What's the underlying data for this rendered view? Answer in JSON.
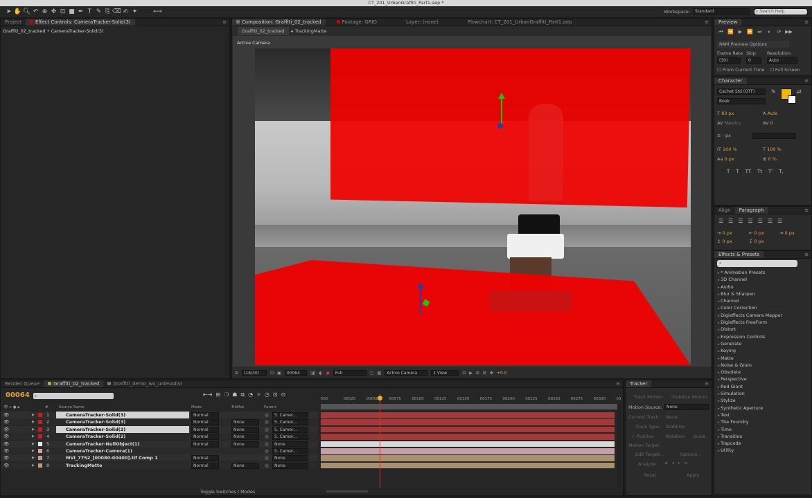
{
  "window": {
    "title": "CT_201_UrbanGraffiti_Part1.aep *"
  },
  "toolbar": {
    "workspace_label": "Workspace:",
    "workspace_value": "Standard",
    "search_placeholder": "Search Help"
  },
  "project_panel": {
    "tab_project": "Project",
    "tab_effect_controls": "Effect Controls: CameraTracker-Solid(3)",
    "breadcrumb": "Graffiti_02_tracked • CameraTracker-Solid(3)"
  },
  "comp_panel": {
    "tab_composition": "Composition: Graffiti_02_tracked",
    "tab_footage": "Footage: GRID",
    "tab_layer": "Layer: (none)",
    "tab_flowchart": "Flowchart: CT_201_UrbanGraffiti_Part1.aep",
    "sub_tab_comp": "Graffiti_02_tracked",
    "sub_tab_matte": "TrackingMatte",
    "view_label": "Active Camera",
    "footer": {
      "zoom": "(16|30)",
      "timecode": "00064",
      "resolution": "Full",
      "camera": "Active Camera",
      "views": "1 View",
      "exposure": "+0.0"
    }
  },
  "preview": {
    "title": "Preview",
    "ram_options": "RAM Preview Options",
    "frame_rate_label": "Frame Rate",
    "skip_label": "Skip",
    "resolution_label": "Resolution",
    "frame_rate": "(30)",
    "skip": "0",
    "resolution": "Auto",
    "from_current": "From Current Time",
    "full_screen": "Full Screen"
  },
  "character": {
    "title": "Character",
    "font": "Cachet Std (OTF)",
    "style": "Book",
    "size": "83 px",
    "leading": "Auto",
    "kerning": "Metrics",
    "tracking": "0",
    "stroke": "- px",
    "vscale": "100 %",
    "hscale": "100 %",
    "baseline": "0 px",
    "tsume": "0 %",
    "fill_color": "#f5b800",
    "style_buttons": [
      "T",
      "T",
      "TT",
      "Tt",
      "T'",
      "T,"
    ]
  },
  "paragraph": {
    "tab_align": "Align",
    "tab_paragraph": "Paragraph",
    "indent_left": "0 px",
    "indent_right": "0 px",
    "indent_first": "0 px",
    "space_before": "0 px",
    "space_after": "0 px"
  },
  "effects": {
    "title": "Effects & Presets",
    "items": [
      "* Animation Presets",
      "3D Channel",
      "Audio",
      "Blur & Sharpen",
      "Channel",
      "Color Correction",
      "Digieffects Camera Mapper",
      "Digieffects FreeForm",
      "Distort",
      "Expression Controls",
      "Generate",
      "Keying",
      "Matte",
      "Noise & Grain",
      "Obsolete",
      "Perspective",
      "Red Giant",
      "Simulation",
      "Stylize",
      "Synthetic Aperture",
      "Text",
      "The Foundry",
      "Time",
      "Transition",
      "Trapcode",
      "Utility"
    ]
  },
  "timeline": {
    "tab_render": "Render Queue",
    "tab_comp": "Graffiti_02_tracked",
    "tab_demo": "Graffiti_demo_wo_unlessdist",
    "timecode": "00064",
    "col_source": "Source Name",
    "col_mode": "Mode",
    "col_trkmat": "TrkMat",
    "col_parent": "Parent",
    "toggle": "Toggle Switches / Modes",
    "ruler": [
      "000",
      "00025",
      "00050",
      "00075",
      "00100",
      "00125",
      "00150",
      "00175",
      "00200",
      "00225",
      "00250",
      "00275",
      "00300",
      "00"
    ],
    "playhead_fraction": 0.198,
    "layers": [
      {
        "num": "1",
        "name": "CameraTracker-Solid(3)",
        "color": "#d21a1a",
        "mode": "Normal",
        "trkmat": "",
        "parent": "5. Camer...",
        "selected": true
      },
      {
        "num": "2",
        "name": "CameraTracker-Solid(3)",
        "color": "#d21a1a",
        "mode": "Normal",
        "trkmat": "None",
        "parent": "5. Camer...",
        "selected": false
      },
      {
        "num": "3",
        "name": "CameraTracker-Solid(2)",
        "color": "#d21a1a",
        "mode": "Normal",
        "trkmat": "None",
        "parent": "5. Camer...",
        "selected": true
      },
      {
        "num": "4",
        "name": "CameraTracker-Solid(2)",
        "color": "#d21a1a",
        "mode": "Normal",
        "trkmat": "None",
        "parent": "5. Camer...",
        "selected": false
      },
      {
        "num": "5",
        "name": "CameraTracker-NullObject(1)",
        "color": "#e8e8e8",
        "mode": "Normal",
        "trkmat": "None",
        "parent": "None",
        "selected": false
      },
      {
        "num": "6",
        "name": "CameraTracker-Camera(1)",
        "color": "#d8a0a8",
        "mode": "",
        "trkmat": "",
        "parent": "5. Camer...",
        "selected": false
      },
      {
        "num": "7",
        "name": "MVI_7752_[00080-00400].tif Comp 1",
        "color": "#b8a080",
        "mode": "Normal",
        "trkmat": "",
        "parent": "None",
        "selected": false
      },
      {
        "num": "8",
        "name": "TrackingMatte",
        "color": "#b8a080",
        "mode": "Normal",
        "trkmat": "None",
        "parent": "None",
        "selected": false
      }
    ]
  },
  "tracker": {
    "title": "Tracker",
    "track_motion": "Track Motion",
    "stabilize_motion": "Stabilize Motion",
    "motion_source_label": "Motion Source:",
    "motion_source": "None",
    "current_track_label": "Current Track:",
    "current_track": "None",
    "track_type_label": "Track Type:",
    "track_type": "Stabilize",
    "position": "Position",
    "rotation": "Rotation",
    "scale": "Scale",
    "motion_target": "Motion Target:",
    "edit_target": "Edit Target...",
    "options": "Options...",
    "analyze": "Analyze:",
    "reset": "Reset",
    "apply": "Apply"
  }
}
